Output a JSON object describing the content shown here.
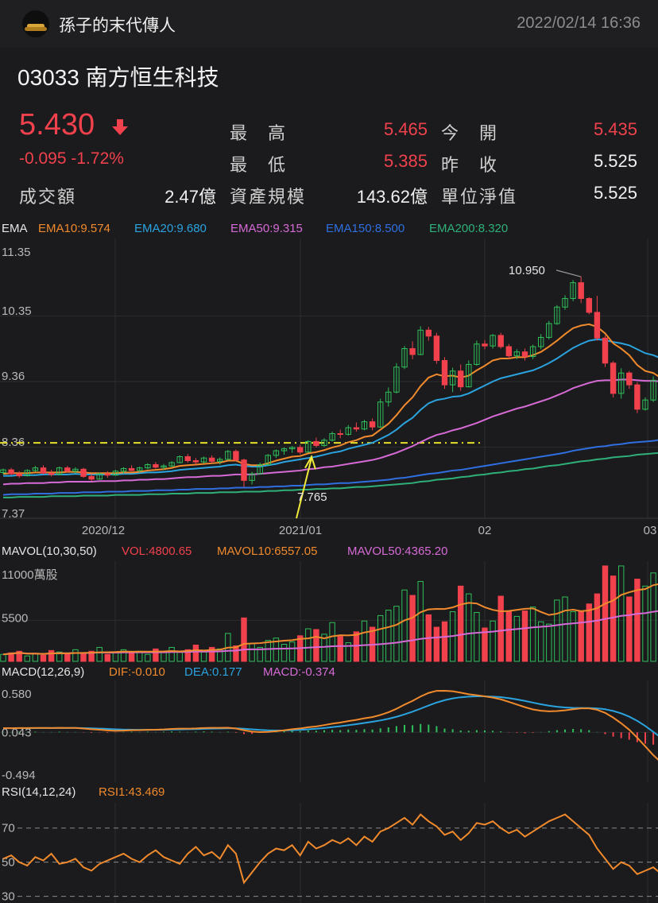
{
  "header": {
    "username": "孫子的末代傳人",
    "datetime": "2022/02/14 16:36"
  },
  "stock": {
    "code_name": "03033  南方恒生科技",
    "price": "5.430",
    "change": "-0.095  -1.72%"
  },
  "quote": {
    "high_label": "最　高",
    "high": "5.465",
    "open_label": "今　開",
    "open": "5.435",
    "low_label": "最　低",
    "low": "5.385",
    "prev_label": "昨　收",
    "prev": "5.525",
    "turnover_label": "成交額",
    "turnover": "2.47億",
    "aum_label": "資產規模",
    "aum": "143.62億",
    "nav_label": "單位淨值",
    "nav": "5.525"
  },
  "ema": {
    "title": "EMA",
    "ema10": "EMA10:9.574",
    "ema20": "EMA20:9.680",
    "ema50": "EMA50:9.315",
    "ema150": "EMA150:8.500",
    "ema200": "EMA200:8.320",
    "y_ticks": [
      "11.35",
      "10.35",
      "9.36",
      "8.36",
      "7.37"
    ],
    "x_ticks": [
      "2020/12",
      "2021/01",
      "02",
      "03"
    ],
    "high_annotation": "10.950",
    "low_annotation": "7.765",
    "colors": {
      "ema10": "#f08a2c",
      "ema20": "#2aa3df",
      "ema50": "#d66ad6",
      "ema150": "#2f6fe0",
      "ema200": "#2fb07a",
      "up": "#2fbf5a",
      "down": "#f0414c"
    }
  },
  "mavol": {
    "title": "MAVOL(10,30,50)",
    "vol": "VOL:4800.65",
    "mavol10": "MAVOL10:6557.05",
    "mavol50": "MAVOL50:4365.20",
    "y_ticks": [
      "11000萬股",
      "5500"
    ]
  },
  "macd": {
    "title": "MACD(12,26,9)",
    "dif": "DIF:-0.010",
    "dea": "DEA:0.177",
    "macd": "MACD:-0.374",
    "y_ticks": [
      "0.580",
      "0.043",
      "-0.494"
    ]
  },
  "rsi": {
    "title": "RSI(14,12,24)",
    "rsi1": "RSI1:43.469",
    "y_ticks": [
      "70",
      "50",
      "30"
    ]
  },
  "chart_data": {
    "type": "candlestick",
    "title": "EMA",
    "ylim": [
      7.37,
      11.35
    ],
    "x_ticks": [
      "2020/12",
      "2021/01",
      "02",
      "03"
    ],
    "annotations": [
      {
        "label": "10.950",
        "kind": "high"
      },
      {
        "label": "7.765",
        "kind": "low"
      }
    ],
    "reference_level": 8.43,
    "candles": [
      [
        7.98,
        8.04,
        7.95,
        8.02
      ],
      [
        8.02,
        8.05,
        7.94,
        7.96
      ],
      [
        7.96,
        8.0,
        7.9,
        7.93
      ],
      [
        7.93,
        8.03,
        7.92,
        8.01
      ],
      [
        8.01,
        8.08,
        7.99,
        8.05
      ],
      [
        8.05,
        8.09,
        7.95,
        7.97
      ],
      [
        7.97,
        8.02,
        7.92,
        7.95
      ],
      [
        7.95,
        8.07,
        7.94,
        8.05
      ],
      [
        8.05,
        8.08,
        7.98,
        8.0
      ],
      [
        8.0,
        8.06,
        7.96,
        8.03
      ],
      [
        8.03,
        8.05,
        7.9,
        7.92
      ],
      [
        7.92,
        7.96,
        7.85,
        7.88
      ],
      [
        7.88,
        7.98,
        7.87,
        7.96
      ],
      [
        7.96,
        8.0,
        7.9,
        7.94
      ],
      [
        7.94,
        8.02,
        7.93,
        8.0
      ],
      [
        8.0,
        8.06,
        7.97,
        8.04
      ],
      [
        8.04,
        8.09,
        8.0,
        8.01
      ],
      [
        8.01,
        8.07,
        7.98,
        8.05
      ],
      [
        8.05,
        8.12,
        8.03,
        8.1
      ],
      [
        8.1,
        8.14,
        8.04,
        8.06
      ],
      [
        8.06,
        8.11,
        8.02,
        8.08
      ],
      [
        8.08,
        8.15,
        8.06,
        8.13
      ],
      [
        8.13,
        8.24,
        8.12,
        8.22
      ],
      [
        8.22,
        8.26,
        8.13,
        8.16
      ],
      [
        8.16,
        8.2,
        8.1,
        8.14
      ],
      [
        8.14,
        8.22,
        8.12,
        8.2
      ],
      [
        8.2,
        8.24,
        8.12,
        8.15
      ],
      [
        8.15,
        8.21,
        8.1,
        8.18
      ],
      [
        8.18,
        8.32,
        8.17,
        8.3
      ],
      [
        8.3,
        8.33,
        8.15,
        8.17
      ],
      [
        8.17,
        8.19,
        7.76,
        7.86
      ],
      [
        7.86,
        7.99,
        7.8,
        7.96
      ],
      [
        7.96,
        8.13,
        7.95,
        8.1
      ],
      [
        8.1,
        8.26,
        8.08,
        8.24
      ],
      [
        8.24,
        8.33,
        8.2,
        8.31
      ],
      [
        8.31,
        8.36,
        8.25,
        8.34
      ],
      [
        8.34,
        8.38,
        8.28,
        8.36
      ],
      [
        8.36,
        8.4,
        8.26,
        8.29
      ],
      [
        8.29,
        8.47,
        8.28,
        8.45
      ],
      [
        8.45,
        8.51,
        8.36,
        8.39
      ],
      [
        8.39,
        8.5,
        8.37,
        8.47
      ],
      [
        8.47,
        8.6,
        8.45,
        8.57
      ],
      [
        8.57,
        8.63,
        8.5,
        8.56
      ],
      [
        8.56,
        8.7,
        8.54,
        8.66
      ],
      [
        8.66,
        8.74,
        8.6,
        8.64
      ],
      [
        8.64,
        8.78,
        8.62,
        8.75
      ],
      [
        8.75,
        8.8,
        8.62,
        8.67
      ],
      [
        8.67,
        9.1,
        8.66,
        9.05
      ],
      [
        9.05,
        9.27,
        8.98,
        9.2
      ],
      [
        9.2,
        9.64,
        9.18,
        9.58
      ],
      [
        9.58,
        9.9,
        9.55,
        9.86
      ],
      [
        9.86,
        9.97,
        9.7,
        9.77
      ],
      [
        9.77,
        10.2,
        9.76,
        10.14
      ],
      [
        10.14,
        10.19,
        9.98,
        10.05
      ],
      [
        10.05,
        10.1,
        9.63,
        9.68
      ],
      [
        9.68,
        9.73,
        9.25,
        9.31
      ],
      [
        9.31,
        9.57,
        9.2,
        9.52
      ],
      [
        9.52,
        9.62,
        9.22,
        9.28
      ],
      [
        9.28,
        9.68,
        9.27,
        9.62
      ],
      [
        9.62,
        9.98,
        9.6,
        9.93
      ],
      [
        9.93,
        9.99,
        9.85,
        9.9
      ],
      [
        9.9,
        10.08,
        9.86,
        10.06
      ],
      [
        10.06,
        10.1,
        9.86,
        9.89
      ],
      [
        9.89,
        9.93,
        9.7,
        9.75
      ],
      [
        9.75,
        9.85,
        9.7,
        9.81
      ],
      [
        9.81,
        9.86,
        9.68,
        9.74
      ],
      [
        9.74,
        9.92,
        9.7,
        9.89
      ],
      [
        9.89,
        10.08,
        9.85,
        10.03
      ],
      [
        10.03,
        10.28,
        10.0,
        10.24
      ],
      [
        10.24,
        10.52,
        10.22,
        10.49
      ],
      [
        10.49,
        10.67,
        10.45,
        10.62
      ],
      [
        10.62,
        10.9,
        10.58,
        10.86
      ],
      [
        10.86,
        10.95,
        10.55,
        10.62
      ],
      [
        10.62,
        10.64,
        10.38,
        10.41
      ],
      [
        10.41,
        10.66,
        9.98,
        10.02
      ],
      [
        10.02,
        10.06,
        9.58,
        9.64
      ],
      [
        9.64,
        9.67,
        9.12,
        9.18
      ],
      [
        9.18,
        9.56,
        9.1,
        9.49
      ],
      [
        9.49,
        9.52,
        9.25,
        9.31
      ],
      [
        9.31,
        9.35,
        8.88,
        8.94
      ],
      [
        8.94,
        9.12,
        8.92,
        9.08
      ],
      [
        9.08,
        9.44,
        9.05,
        9.38
      ],
      [
        9.38,
        9.41,
        9.02,
        9.07
      ]
    ],
    "series": [
      {
        "name": "EMA10",
        "values": [
          7.96,
          7.97,
          7.97,
          7.97,
          7.98,
          7.98,
          7.98,
          7.98,
          7.99,
          7.99,
          7.98,
          7.97,
          7.97,
          7.97,
          7.97,
          7.98,
          7.98,
          7.99,
          8.01,
          8.02,
          8.03,
          8.05,
          8.08,
          8.09,
          8.1,
          8.11,
          8.12,
          8.13,
          8.16,
          8.16,
          8.11,
          8.09,
          8.09,
          8.12,
          8.16,
          8.19,
          8.22,
          8.23,
          8.27,
          8.29,
          8.32,
          8.36,
          8.39,
          8.44,
          8.47,
          8.52,
          8.54,
          8.63,
          8.72,
          8.85,
          9.0,
          9.12,
          9.29,
          9.42,
          9.47,
          9.44,
          9.45,
          9.42,
          9.45,
          9.53,
          9.6,
          9.68,
          9.71,
          9.71,
          9.73,
          9.73,
          9.76,
          9.81,
          9.89,
          9.98,
          10.08,
          10.17,
          10.21,
          10.23,
          10.19,
          10.09,
          9.94,
          9.86,
          9.76,
          9.61,
          9.52,
          9.49,
          9.41
        ]
      },
      {
        "name": "EMA20",
        "values": [
          7.93,
          7.93,
          7.94,
          7.94,
          7.94,
          7.95,
          7.95,
          7.95,
          7.95,
          7.96,
          7.95,
          7.95,
          7.95,
          7.95,
          7.95,
          7.96,
          7.96,
          7.97,
          7.98,
          7.98,
          7.99,
          8.0,
          8.02,
          8.03,
          8.04,
          8.05,
          8.06,
          8.07,
          8.09,
          8.1,
          8.08,
          8.07,
          8.07,
          8.09,
          8.11,
          8.14,
          8.16,
          8.18,
          8.2,
          8.22,
          8.25,
          8.28,
          8.3,
          8.34,
          8.37,
          8.4,
          8.43,
          8.49,
          8.55,
          8.63,
          8.73,
          8.81,
          8.93,
          9.03,
          9.08,
          9.1,
          9.13,
          9.14,
          9.18,
          9.24,
          9.3,
          9.36,
          9.41,
          9.44,
          9.47,
          9.5,
          9.53,
          9.58,
          9.64,
          9.71,
          9.79,
          9.87,
          9.93,
          9.98,
          10.0,
          9.99,
          9.96,
          9.94,
          9.91,
          9.85,
          9.79,
          9.76,
          9.71
        ]
      },
      {
        "name": "EMA50",
        "values": [
          7.8,
          7.81,
          7.81,
          7.82,
          7.82,
          7.82,
          7.83,
          7.83,
          7.84,
          7.84,
          7.84,
          7.84,
          7.85,
          7.85,
          7.85,
          7.86,
          7.86,
          7.87,
          7.87,
          7.88,
          7.88,
          7.89,
          7.9,
          7.91,
          7.91,
          7.92,
          7.93,
          7.93,
          7.94,
          7.95,
          7.95,
          7.95,
          7.96,
          7.97,
          7.98,
          7.99,
          8.0,
          8.01,
          8.03,
          8.04,
          8.06,
          8.07,
          8.09,
          8.11,
          8.13,
          8.15,
          8.17,
          8.2,
          8.24,
          8.28,
          8.33,
          8.38,
          8.44,
          8.5,
          8.55,
          8.58,
          8.62,
          8.65,
          8.69,
          8.73,
          8.78,
          8.83,
          8.87,
          8.91,
          8.95,
          8.98,
          9.02,
          9.06,
          9.1,
          9.15,
          9.2,
          9.26,
          9.3,
          9.34,
          9.37,
          9.38,
          9.38,
          9.39,
          9.39,
          9.38,
          9.37,
          9.37,
          9.36
        ]
      },
      {
        "name": "EMA150",
        "values": [
          7.64,
          7.65,
          7.65,
          7.65,
          7.66,
          7.66,
          7.66,
          7.67,
          7.67,
          7.67,
          7.68,
          7.68,
          7.68,
          7.69,
          7.69,
          7.69,
          7.7,
          7.7,
          7.7,
          7.71,
          7.71,
          7.71,
          7.72,
          7.72,
          7.73,
          7.73,
          7.73,
          7.74,
          7.74,
          7.75,
          7.75,
          7.75,
          7.76,
          7.76,
          7.77,
          7.77,
          7.78,
          7.78,
          7.79,
          7.8,
          7.8,
          7.81,
          7.82,
          7.82,
          7.83,
          7.84,
          7.85,
          7.86,
          7.87,
          7.89,
          7.9,
          7.92,
          7.94,
          7.96,
          7.97,
          7.99,
          8.01,
          8.02,
          8.04,
          8.06,
          8.08,
          8.1,
          8.12,
          8.14,
          8.16,
          8.18,
          8.2,
          8.22,
          8.24,
          8.26,
          8.28,
          8.31,
          8.33,
          8.35,
          8.37,
          8.38,
          8.4,
          8.41,
          8.43,
          8.44,
          8.45,
          8.46,
          8.48
        ]
      },
      {
        "name": "EMA200",
        "values": [
          7.6,
          7.6,
          7.61,
          7.61,
          7.61,
          7.61,
          7.62,
          7.62,
          7.62,
          7.62,
          7.63,
          7.63,
          7.63,
          7.63,
          7.64,
          7.64,
          7.64,
          7.64,
          7.65,
          7.65,
          7.65,
          7.66,
          7.66,
          7.66,
          7.67,
          7.67,
          7.67,
          7.68,
          7.68,
          7.68,
          7.69,
          7.69,
          7.69,
          7.7,
          7.7,
          7.71,
          7.71,
          7.72,
          7.72,
          7.73,
          7.73,
          7.74,
          7.74,
          7.75,
          7.76,
          7.76,
          7.77,
          7.78,
          7.79,
          7.8,
          7.81,
          7.82,
          7.84,
          7.85,
          7.87,
          7.88,
          7.89,
          7.91,
          7.92,
          7.94,
          7.95,
          7.97,
          7.98,
          8.0,
          8.01,
          8.03,
          8.04,
          8.06,
          8.08,
          8.09,
          8.11,
          8.13,
          8.15,
          8.16,
          8.18,
          8.19,
          8.21,
          8.22,
          8.23,
          8.25,
          8.26,
          8.27,
          8.28
        ]
      }
    ],
    "volume": [
      900,
      1100,
      1300,
      700,
      1000,
      800,
      1400,
      1200,
      900,
      1500,
      1000,
      1300,
      1800,
      900,
      1200,
      1500,
      1100,
      1300,
      900,
      1600,
      1200,
      1800,
      1300,
      1500,
      2100,
      1200,
      1800,
      1600,
      3600,
      2000,
      5600,
      2300,
      1800,
      2700,
      3000,
      2200,
      2500,
      3300,
      4200,
      4100,
      3500,
      5000,
      3200,
      2400,
      3800,
      5200,
      4400,
      5900,
      6600,
      7100,
      9200,
      8500,
      10300,
      6000,
      4400,
      5100,
      6400,
      9700,
      8700,
      6300,
      4300,
      5200,
      8400,
      6400,
      5800,
      6500,
      7000,
      5100,
      4800,
      7900,
      8300,
      6400,
      6500,
      7400,
      8700,
      12300,
      11000,
      12300,
      8300,
      10600,
      9700,
      11400,
      8600
    ],
    "rsi": [
      52,
      54,
      50,
      48,
      53,
      51,
      55,
      49,
      50,
      52,
      47,
      45,
      49,
      51,
      53,
      55,
      52,
      50,
      54,
      57,
      53,
      51,
      49,
      55,
      59,
      54,
      56,
      52,
      60,
      55,
      38,
      44,
      50,
      55,
      58,
      57,
      60,
      54,
      62,
      58,
      60,
      63,
      61,
      64,
      60,
      65,
      62,
      68,
      70,
      73,
      76,
      72,
      78,
      74,
      71,
      66,
      68,
      63,
      67,
      73,
      72,
      74,
      70,
      67,
      69,
      65,
      68,
      71,
      74,
      76,
      78,
      74,
      70,
      66,
      58,
      52,
      46,
      50,
      48,
      43,
      45,
      47,
      43
    ],
    "macd_hist": [
      0.01,
      0.01,
      0.02,
      0.01,
      0.02,
      0.01,
      0.01,
      0.02,
      0.01,
      0.01,
      -0.01,
      -0.02,
      -0.01,
      -0.02,
      -0.01,
      0.01,
      0.02,
      0.01,
      0.02,
      0.01,
      0.02,
      0.03,
      0.02,
      0.01,
      0.02,
      0.03,
      0.02,
      0.01,
      0.02,
      -0.02,
      -0.06,
      -0.05,
      -0.02,
      0.01,
      0.03,
      0.04,
      0.05,
      0.04,
      0.06,
      0.05,
      0.07,
      0.08,
      0.07,
      0.09,
      0.08,
      0.1,
      0.09,
      0.13,
      0.16,
      0.2,
      0.24,
      0.23,
      0.27,
      0.25,
      0.2,
      0.12,
      0.1,
      0.06,
      0.05,
      0.07,
      0.06,
      0.05,
      0.03,
      -0.01,
      -0.02,
      -0.03,
      -0.02,
      0.01,
      0.04,
      0.07,
      0.09,
      0.11,
      0.1,
      0.07,
      0.01,
      -0.06,
      -0.14,
      -0.19,
      -0.24,
      -0.32,
      -0.37,
      -0.4,
      -0.37
    ]
  }
}
